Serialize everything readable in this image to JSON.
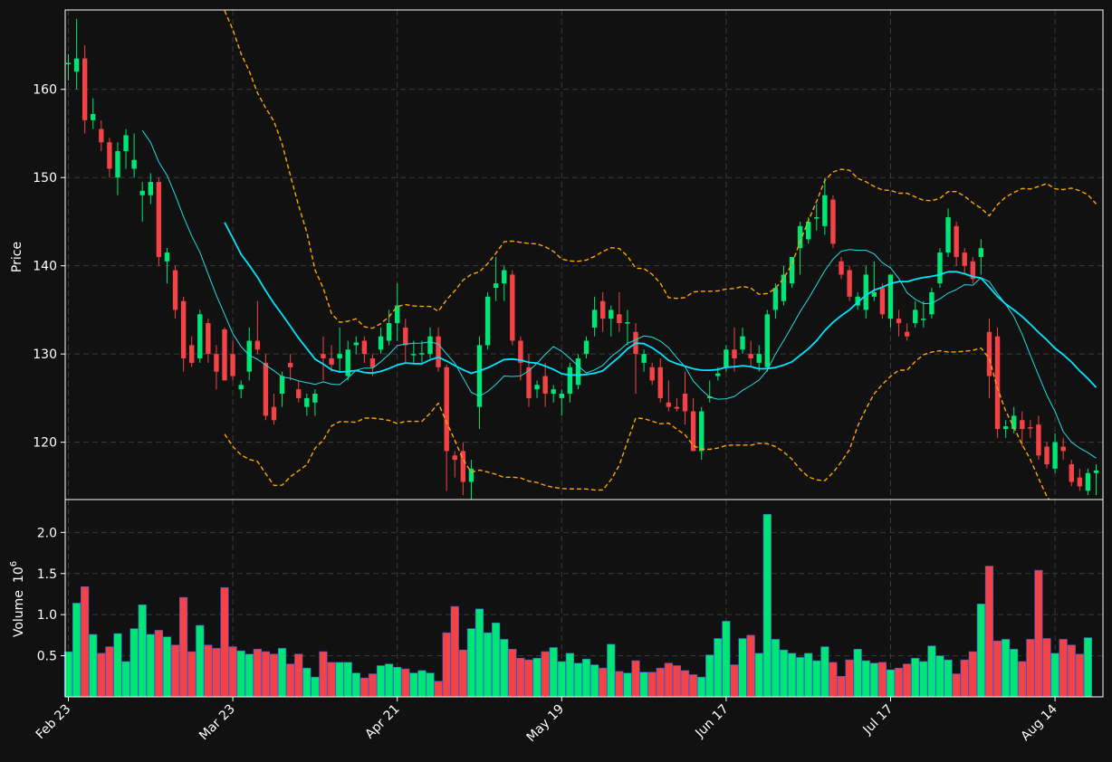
{
  "chart_data": {
    "type": "candlestick",
    "title": "",
    "panels": {
      "price": {
        "ylabel": "Price",
        "ylim": [
          113.5,
          169
        ],
        "yticks": [
          120,
          130,
          140,
          150,
          160
        ]
      },
      "volume": {
        "ylabel": "Volume",
        "ylabel_exponent": "10",
        "ylabel_power": "6",
        "ylim": [
          0,
          2.4
        ],
        "yticks": [
          0.5,
          1.0,
          1.5,
          2.0
        ],
        "ytick_labels": [
          "0.5",
          "1.0",
          "1.5",
          "2.0"
        ]
      }
    },
    "xticks": [
      {
        "index": 0,
        "label": "Feb 23"
      },
      {
        "index": 20,
        "label": "Mar 23"
      },
      {
        "index": 40,
        "label": "Apr 21"
      },
      {
        "index": 60,
        "label": "May 19"
      },
      {
        "index": 80,
        "label": "Jun 17"
      },
      {
        "index": 100,
        "label": "Jul 17"
      },
      {
        "index": 120,
        "label": "Aug 14"
      }
    ],
    "grid": true,
    "colors": {
      "background": "#111111",
      "up": "#00e676",
      "down": "#f44346",
      "ma_short": "#26d9e0",
      "ma_long": "#00e5ff",
      "bands": "#ffa500",
      "grid": "#3a3a3a",
      "axes": "#ffffff"
    },
    "overlays": [
      {
        "type": "moving_average_short",
        "window": 10,
        "style": "thin solid"
      },
      {
        "type": "moving_average_long",
        "window": 20,
        "style": "solid"
      },
      {
        "type": "bollinger_bands",
        "window": 20,
        "std": 2,
        "style": "dashed"
      }
    ],
    "ohlc": [
      [
        163,
        164,
        161,
        163
      ],
      [
        162,
        168,
        160,
        163.5
      ],
      [
        163.5,
        165,
        155,
        156.5
      ],
      [
        156.5,
        159,
        155.5,
        157.2
      ],
      [
        155.5,
        156.5,
        153,
        154
      ],
      [
        154,
        154.5,
        150,
        151
      ],
      [
        150,
        154,
        148,
        153
      ],
      [
        153,
        155.5,
        151,
        154.8
      ],
      [
        151,
        155,
        150,
        152
      ],
      [
        148,
        149.5,
        145,
        148.5
      ],
      [
        148,
        150.5,
        147,
        149.5
      ],
      [
        149.5,
        150,
        140,
        141
      ],
      [
        140.5,
        142,
        138,
        141.5
      ],
      [
        139.5,
        140,
        134,
        135
      ],
      [
        136,
        136.5,
        128,
        129.5
      ],
      [
        131,
        132,
        128.5,
        129
      ],
      [
        129.5,
        135,
        129,
        134.5
      ],
      [
        133.5,
        134,
        129,
        130
      ],
      [
        130,
        131,
        126,
        128
      ],
      [
        132.8,
        133,
        127,
        127
      ],
      [
        130,
        131.5,
        127,
        127.5
      ],
      [
        126,
        127,
        125,
        126.5
      ],
      [
        128,
        133,
        127,
        131.5
      ],
      [
        131.5,
        136,
        130,
        130.5
      ],
      [
        129,
        130,
        122.5,
        123
      ],
      [
        124,
        125.5,
        122,
        122.5
      ],
      [
        125.5,
        128,
        124,
        127.5
      ],
      [
        129,
        130,
        127,
        128.5
      ],
      [
        126,
        127,
        124.5,
        125
      ],
      [
        124,
        125.5,
        123,
        125
      ],
      [
        124.5,
        126,
        123,
        125.5
      ],
      [
        130,
        132,
        127,
        129.5
      ],
      [
        129.5,
        131,
        128,
        128.8
      ],
      [
        129.5,
        133,
        128,
        130
      ],
      [
        127.5,
        131.5,
        127,
        130.5
      ],
      [
        131,
        132,
        130,
        131.3
      ],
      [
        131.5,
        132,
        129,
        130
      ],
      [
        129.5,
        130,
        127.5,
        128.5
      ],
      [
        130.5,
        133,
        130,
        132
      ],
      [
        131.5,
        135,
        131,
        133.5
      ],
      [
        133.5,
        138,
        131.5,
        135.5
      ],
      [
        133,
        134,
        129,
        131
      ],
      [
        130,
        131.5,
        129,
        130
      ],
      [
        130,
        131.5,
        129,
        130.1
      ],
      [
        130,
        133,
        129.5,
        132
      ],
      [
        132,
        133,
        128,
        128.5
      ],
      [
        128.5,
        128.8,
        114.5,
        119
      ],
      [
        118.5,
        119,
        116,
        118
      ],
      [
        119,
        120,
        114,
        115.5
      ],
      [
        115.5,
        118,
        113.5,
        117
      ],
      [
        124,
        132,
        121.5,
        131
      ],
      [
        131,
        137,
        130.5,
        136.5
      ],
      [
        137.5,
        141,
        136,
        138
      ],
      [
        138,
        140,
        136,
        139.5
      ],
      [
        139,
        139.5,
        131,
        131.5
      ],
      [
        131.5,
        132,
        127,
        129
      ],
      [
        128.5,
        130,
        124,
        125
      ],
      [
        126,
        127,
        125,
        126.5
      ],
      [
        127.5,
        129,
        124,
        125.5
      ],
      [
        125.5,
        126.5,
        124.5,
        126
      ],
      [
        125,
        126,
        123,
        125.5
      ],
      [
        125.5,
        129,
        124.5,
        128.5
      ],
      [
        126.5,
        130,
        126,
        129.5
      ],
      [
        130,
        132,
        129.5,
        131.5
      ],
      [
        133,
        136.5,
        132,
        135
      ],
      [
        136,
        137,
        132.5,
        134
      ],
      [
        134,
        135.5,
        132,
        135
      ],
      [
        134.5,
        137,
        132.5,
        133.5
      ],
      [
        133.5,
        135,
        131,
        133.6
      ],
      [
        132.5,
        133.5,
        125.5,
        130
      ],
      [
        129,
        130.5,
        128,
        130
      ],
      [
        128.5,
        129,
        126.5,
        127
      ],
      [
        128.5,
        129.5,
        124.5,
        125
      ],
      [
        124.5,
        127,
        123.5,
        124
      ],
      [
        124,
        125,
        123.5,
        123.8
      ],
      [
        125.5,
        128,
        122,
        123.5
      ],
      [
        123.5,
        125,
        119,
        119
      ],
      [
        119,
        124,
        118,
        123.5
      ],
      [
        125,
        127,
        124.5,
        125.2
      ],
      [
        127.5,
        128.5,
        127,
        127.8
      ],
      [
        128.5,
        131,
        128,
        130.5
      ],
      [
        130.5,
        133,
        128,
        129.5
      ],
      [
        130.5,
        133,
        130,
        132
      ],
      [
        130,
        131.5,
        128.5,
        129.5
      ],
      [
        129,
        131,
        128,
        130
      ],
      [
        128.5,
        135,
        128,
        134.5
      ],
      [
        135,
        138,
        134,
        137.5
      ],
      [
        136,
        140,
        135.5,
        139
      ],
      [
        138,
        141,
        137.5,
        141
      ],
      [
        142,
        145,
        139,
        144.5
      ],
      [
        143,
        145.5,
        142.5,
        145
      ],
      [
        145.5,
        147,
        144,
        145.5
      ],
      [
        144.5,
        150,
        143.5,
        148
      ],
      [
        147.5,
        148,
        142,
        142.5
      ],
      [
        140.5,
        141,
        138.5,
        139
      ],
      [
        139.5,
        140,
        136,
        136.5
      ],
      [
        135.5,
        137,
        135,
        136.5
      ],
      [
        135,
        140,
        134,
        139
      ],
      [
        136.5,
        140.5,
        136,
        137
      ],
      [
        137.5,
        138,
        134,
        134.5
      ],
      [
        134,
        137,
        133,
        139
      ],
      [
        134,
        135,
        132,
        133.5
      ],
      [
        132.5,
        133.5,
        131.5,
        132
      ],
      [
        133.5,
        136,
        133,
        135
      ],
      [
        134,
        136,
        133,
        134
      ],
      [
        134.5,
        137.5,
        134,
        137
      ],
      [
        138,
        142,
        137.5,
        141.5
      ],
      [
        141.5,
        146.5,
        141,
        145.5
      ],
      [
        144.5,
        145,
        140,
        141
      ],
      [
        141.5,
        142,
        139,
        140
      ],
      [
        140.5,
        141,
        138,
        138.5
      ],
      [
        141,
        143,
        139,
        142
      ],
      [
        132.5,
        134,
        125,
        127.5
      ],
      [
        132,
        133,
        120.5,
        121.5
      ],
      [
        121.5,
        122.5,
        120.5,
        121.8
      ],
      [
        121.5,
        124,
        121,
        123
      ],
      [
        122.5,
        123.5,
        119.5,
        121.5
      ],
      [
        121.7,
        122.5,
        120.5,
        121.6
      ],
      [
        122,
        123,
        118,
        118.5
      ],
      [
        119.5,
        120,
        117,
        117.5
      ],
      [
        117,
        121,
        116.5,
        120
      ],
      [
        119.5,
        120.5,
        118,
        119
      ],
      [
        117.5,
        118,
        115,
        115.5
      ],
      [
        116,
        117,
        114.5,
        115
      ],
      [
        114.5,
        117,
        114,
        116.5
      ],
      [
        116.5,
        117.5,
        114,
        116.8
      ]
    ],
    "volume": [
      0.55,
      1.14,
      1.34,
      0.76,
      0.53,
      0.61,
      0.77,
      0.43,
      0.83,
      1.12,
      0.76,
      0.81,
      0.73,
      0.63,
      1.21,
      0.55,
      0.87,
      0.63,
      0.59,
      1.33,
      0.61,
      0.56,
      0.52,
      0.58,
      0.55,
      0.52,
      0.59,
      0.4,
      0.52,
      0.35,
      0.24,
      0.55,
      0.42,
      0.42,
      0.42,
      0.29,
      0.23,
      0.28,
      0.38,
      0.4,
      0.36,
      0.34,
      0.29,
      0.32,
      0.29,
      0.19,
      0.78,
      1.1,
      0.57,
      0.83,
      1.07,
      0.78,
      0.9,
      0.7,
      0.58,
      0.47,
      0.45,
      0.47,
      0.55,
      0.6,
      0.43,
      0.53,
      0.41,
      0.46,
      0.39,
      0.35,
      0.64,
      0.31,
      0.29,
      0.44,
      0.3,
      0.3,
      0.35,
      0.41,
      0.38,
      0.32,
      0.27,
      0.24,
      0.51,
      0.71,
      0.92,
      0.39,
      0.71,
      0.75,
      0.53,
      2.22,
      0.7,
      0.57,
      0.53,
      0.48,
      0.53,
      0.44,
      0.61,
      0.42,
      0.25,
      0.45,
      0.58,
      0.44,
      0.41,
      0.42,
      0.33,
      0.35,
      0.4,
      0.47,
      0.43,
      0.62,
      0.5,
      0.45,
      0.28,
      0.45,
      0.55,
      1.13,
      1.59,
      0.68,
      0.7,
      0.58,
      0.43,
      0.7,
      1.54,
      0.71,
      0.53,
      0.7,
      0.63,
      0.52,
      0.72
    ]
  }
}
